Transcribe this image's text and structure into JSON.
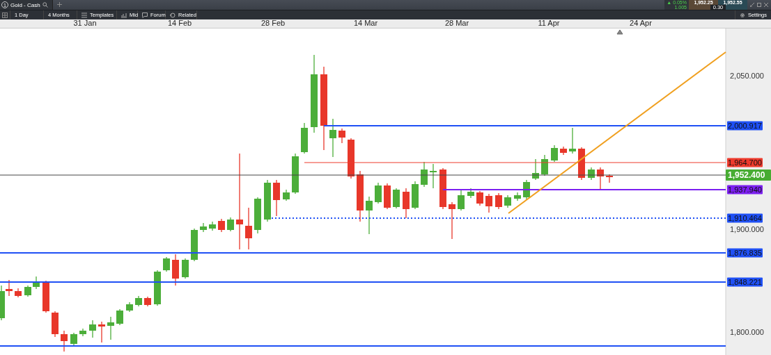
{
  "tab": {
    "number": "1",
    "title": "Gold - Cash"
  },
  "quote": {
    "change": "▲ 0.05%",
    "change_abs": "1.005",
    "bid": "1,952.25",
    "ask": "1,952.55",
    "spread": "0.30"
  },
  "toolbar": {
    "items": [
      {
        "label": "1 Day",
        "kind": "plain"
      },
      {
        "label": "4 Months",
        "kind": "plain"
      },
      {
        "label": "Templates",
        "kind": "templates"
      },
      {
        "label": "Mid",
        "kind": "mid"
      },
      {
        "label": "Forum",
        "kind": "forum"
      },
      {
        "label": "Related",
        "kind": "related"
      }
    ],
    "settings": "Settings"
  },
  "date_axis": [
    "31 Jan",
    "14 Feb",
    "28 Feb",
    "14 Mar",
    "28 Mar",
    "11 Apr",
    "24 Apr"
  ],
  "price_axis": [
    "2,050.000",
    "1,900.000",
    "1,800.000"
  ],
  "levels": [
    {
      "label": "2,000.917",
      "color": "#1f50f5",
      "kind": "line"
    },
    {
      "label": "1,964.700",
      "color": "#ee3a2c",
      "kind": "line"
    },
    {
      "label": "1,952.400",
      "color": "#47ac32",
      "kind": "current"
    },
    {
      "label": "1,937.940",
      "color": "#7b1ff0",
      "kind": "line"
    },
    {
      "label": "1,910.464",
      "color": "#1f50f5",
      "kind": "dotted"
    },
    {
      "label": "1,876.835",
      "color": "#1f50f5",
      "kind": "line"
    },
    {
      "label": "1,848.221",
      "color": "#1f50f5",
      "kind": "line"
    }
  ]
}
